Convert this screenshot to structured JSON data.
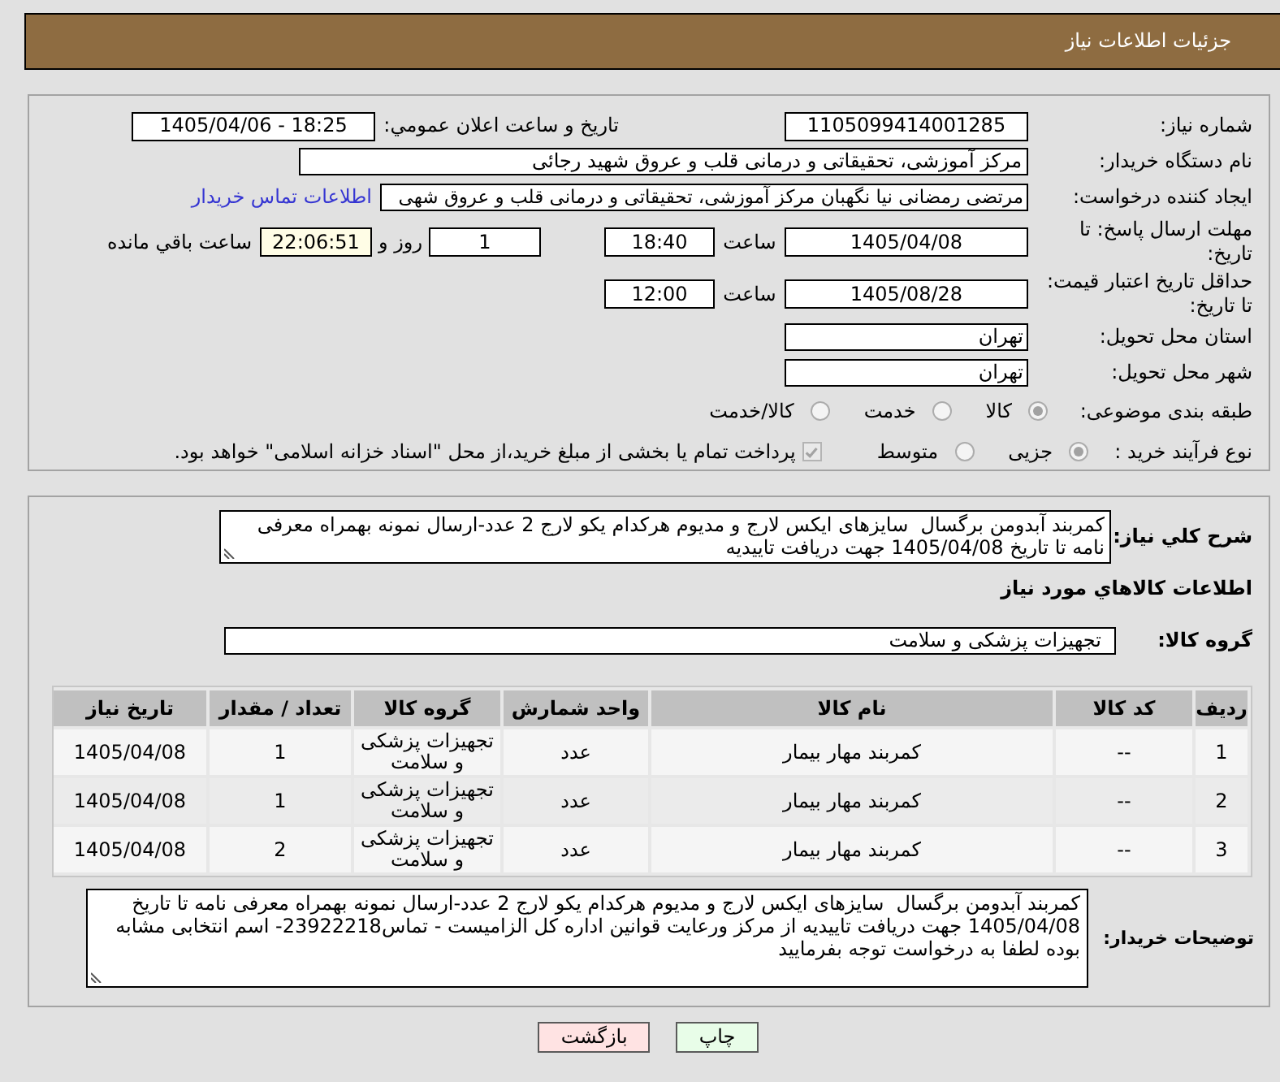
{
  "header": {
    "title": "جزئیات اطلاعات نیاز"
  },
  "need_details": {
    "need_number": {
      "label": "شماره نیاز:",
      "value": "1105099414001285"
    },
    "announcement": {
      "label": "تاریخ و ساعت اعلان عمومي:",
      "value": "1405/04/06 - 18:25"
    },
    "buyer_organization": {
      "label": "نام دستگاه خریدار:",
      "value": "مرکز آموزشی، تحقیقاتی و درمانی قلب و عروق شهید رجائی"
    },
    "requester": {
      "label": "ایجاد کننده درخواست:",
      "value": "مرتضی رمضانی نیا نگهبان مرکز آموزشی، تحقیقاتی و درمانی قلب و عروق شهی",
      "contact_link": "اطلاعات تماس خریدار"
    },
    "response_deadline": {
      "label": "مهلت ارسال پاسخ: تا تاریخ:",
      "date": "1405/04/08",
      "time_label": "ساعت",
      "time": "18:40",
      "days": "1",
      "days_label": "روز و",
      "remaining": "22:06:51",
      "remaining_label": "ساعت باقي مانده"
    },
    "price_validity": {
      "label": "حداقل تاریخ اعتبار قیمت: تا تاریخ:",
      "date": "1405/08/28",
      "time_label": "ساعت",
      "time": "12:00"
    },
    "delivery_province": {
      "label": "استان محل تحویل:",
      "value": "تهران"
    },
    "delivery_city": {
      "label": "شهر محل تحویل:",
      "value": "تهران"
    },
    "subject_category": {
      "label": "طبقه بندی موضوعی:",
      "options": [
        {
          "label": "کالا",
          "selected": true
        },
        {
          "label": "خدمت",
          "selected": false
        },
        {
          "label": "کالا/خدمت",
          "selected": false
        }
      ]
    },
    "purchase_process": {
      "label": "نوع فرآیند خرید :",
      "options": [
        {
          "label": "جزیی",
          "selected": true
        },
        {
          "label": "متوسط",
          "selected": false
        }
      ],
      "treasury_payment": {
        "label": "پرداخت تمام یا بخشی از مبلغ خرید،از محل \"اسناد خزانه اسلامی\" خواهد بود.",
        "checked": true
      }
    }
  },
  "goods_section": {
    "description": {
      "label": "شرح کلي نياز:",
      "value": "کمربند آبدومن برگسال  سایزهای ایکس لارج و مدیوم هرکدام یکو لارج 2 عدد-ارسال نمونه بهمراه معرفی نامه تا تاریخ 1405/04/08 جهت دریافت تاییدیه"
    },
    "title": "اطلاعات کالاهاي مورد نياز",
    "goods_group": {
      "label": "گروه کالا:",
      "value": "تجهیزات پزشکی و سلامت"
    },
    "table": {
      "columns": [
        "ردیف",
        "کد کالا",
        "نام کالا",
        "واحد شمارش",
        "گروه کالا",
        "تعداد / مقدار",
        "تاریخ نیاز"
      ],
      "rows": [
        {
          "cells": [
            "1",
            "--",
            "کمربند مهار بیمار",
            "عدد",
            "تجهیزات پزشکی و سلامت",
            "1",
            "1405/04/08"
          ]
        },
        {
          "cells": [
            "2",
            "--",
            "کمربند مهار بیمار",
            "عدد",
            "تجهیزات پزشکی و سلامت",
            "1",
            "1405/04/08"
          ]
        },
        {
          "cells": [
            "3",
            "--",
            "کمربند مهار بیمار",
            "عدد",
            "تجهیزات پزشکی و سلامت",
            "2",
            "1405/04/08"
          ]
        }
      ]
    },
    "buyer_notes": {
      "label": "توضیحات خریدار:",
      "value": "کمربند آبدومن برگسال  سایزهای ایکس لارج و مدیوم هرکدام یکو لارج 2 عدد-ارسال نمونه بهمراه معرفی نامه تا تاریخ 1405/04/08 جهت دریافت تاییدیه از مرکز ورعایت قوانین اداره کل الزامیست - تماس23922218- اسم انتخابی مشابه بوده لطفا به درخواست توجه بفرمایید"
    }
  },
  "buttons": [
    {
      "label": "چاپ",
      "kind": "print"
    },
    {
      "label": "بازگشت",
      "kind": "back"
    }
  ]
}
